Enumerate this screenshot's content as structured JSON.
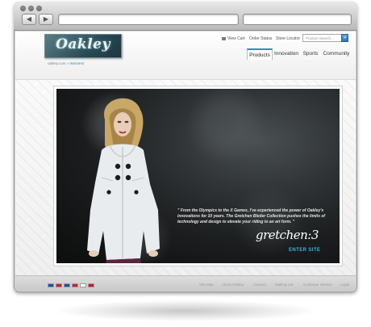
{
  "browser": {
    "back_icon": "back-arrow-icon",
    "forward_icon": "forward-arrow-icon",
    "back_glyph": "◀",
    "forward_glyph": "▶",
    "address_value": "",
    "search_value": ""
  },
  "header": {
    "logo_text": "Oakley",
    "breadcrumb_home": "oakley.com",
    "breadcrumb_sep": "»",
    "breadcrumb_current": "Womens",
    "util_links": [
      "View Cart",
      "Order Status",
      "Store Locator"
    ],
    "search_placeholder": "Product Search...",
    "search_button": "»"
  },
  "nav": {
    "tabs": [
      {
        "label": "Products",
        "active": true
      },
      {
        "label": "Innovation",
        "active": false
      },
      {
        "label": "Sports",
        "active": false
      },
      {
        "label": "Community",
        "active": false
      }
    ]
  },
  "hero": {
    "quote": "\" From the Olympics to the X Games, I've experienced the power of Oakley's innovations for 10 years. The Gretchen Bleiler Collection pushes the limits of technology and design to elevate your riding to an art form. \"",
    "signature": "gretchen:3",
    "cta": "ENTER SITE"
  },
  "footer": {
    "flags": [
      "#1f4fa6",
      "#c8202f",
      "#1f4fa6",
      "#c8202f",
      "#ffffff",
      "#d0122a"
    ],
    "links": [
      "Site Map",
      "About Oakley",
      "Careers",
      "Mailing List",
      "Customer Service",
      "Legal"
    ]
  },
  "colors": {
    "accent": "#2f8fb0",
    "cta": "#3fb4e6",
    "jacket": "#e9ecef"
  }
}
